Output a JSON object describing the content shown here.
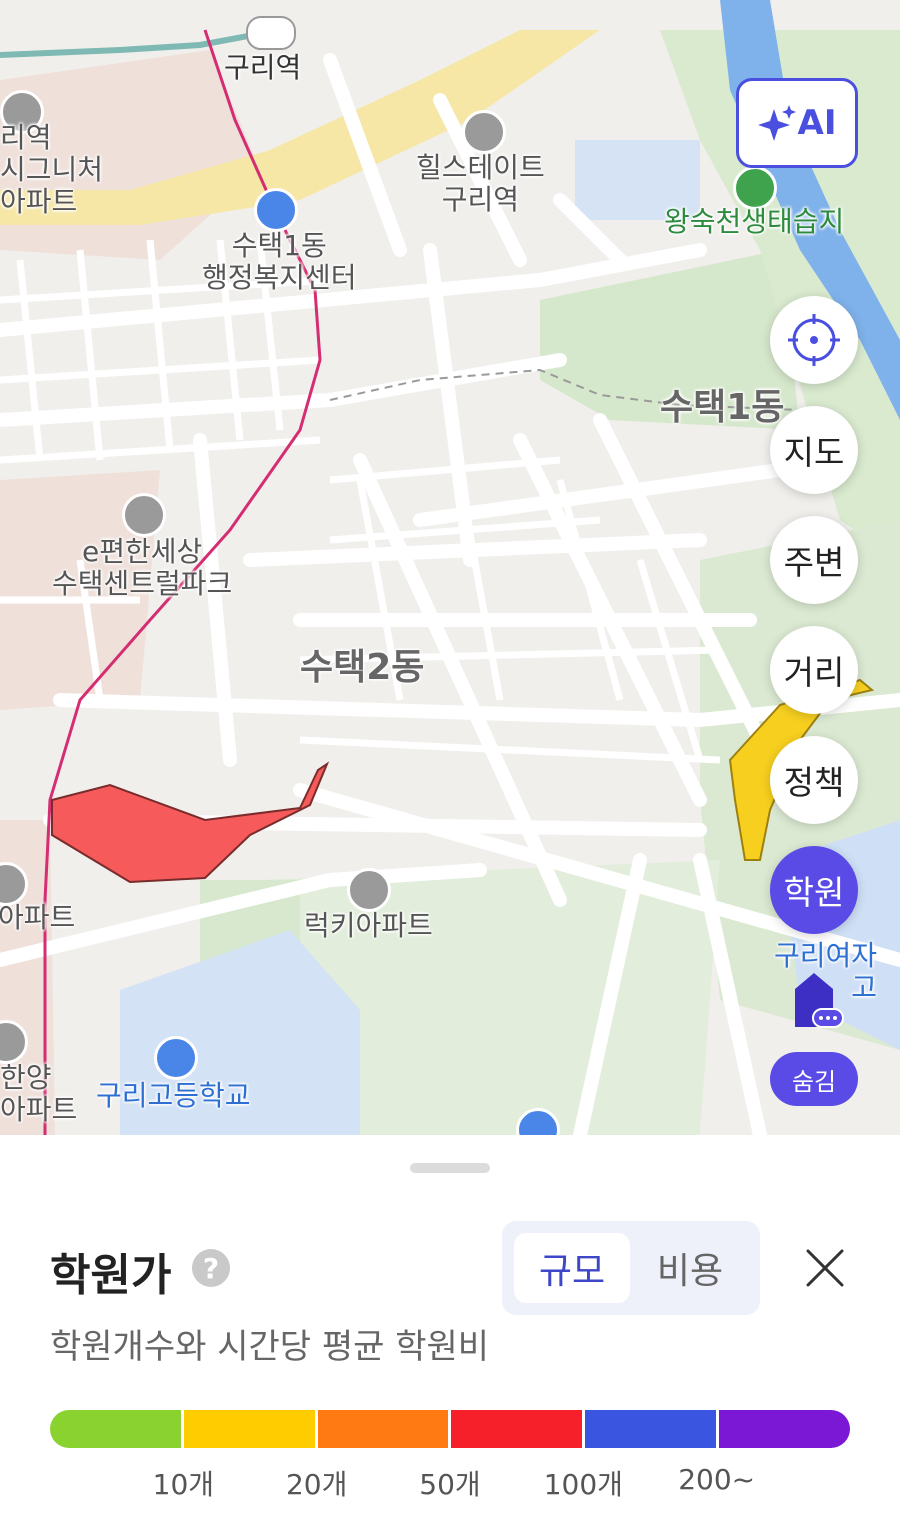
{
  "map": {
    "labels": {
      "guri_station": "구리역",
      "signature_line1": "리역",
      "signature_line2": "시그니처",
      "signature_line3": "아파트",
      "hillstate_line1": "힐스테이트",
      "hillstate_line2": "구리역",
      "wangsuk": "왕숙천생태습지",
      "sutaek1_center_line1": "수택1동",
      "sutaek1_center_line2": "행정복지센터",
      "sutaek1": "수택1동",
      "epyeon_line1": "e편한세상",
      "epyeon_line2": "수택센트럴파크",
      "sutaek2": "수택2동",
      "apt_left": "아파트",
      "lucky_apt": "럭키아파트",
      "hanyang_line1": "한양",
      "hanyang_line2": "아파트",
      "guri_high": "구리고등학교",
      "guri_girls_line1": "구리여자",
      "guri_girls_line2": "고"
    }
  },
  "controls": {
    "ai_label": "AI",
    "side_buttons": [
      "지도",
      "주변",
      "거리",
      "정책",
      "학원"
    ],
    "active_button": "학원",
    "hide_label": "숨김"
  },
  "sheet": {
    "title": "학원가",
    "help": "?",
    "toggle_on": "규모",
    "toggle_off": "비용",
    "subtitle": "학원개수와 시간당 평균 학원비",
    "scale_colors": [
      "#8ad22f",
      "#ffcc00",
      "#ff7a12",
      "#f5202a",
      "#3a55e0",
      "#7a18d6"
    ],
    "scale_ticks": [
      "10개",
      "20개",
      "50개",
      "100개",
      "200~"
    ]
  }
}
